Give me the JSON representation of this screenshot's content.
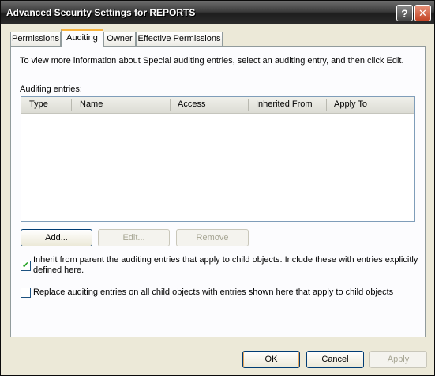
{
  "window": {
    "title": "Advanced Security Settings for REPORTS",
    "help_icon": "?",
    "close_icon": "✕"
  },
  "tabs": [
    {
      "label": "Permissions",
      "active": false
    },
    {
      "label": "Auditing",
      "active": true
    },
    {
      "label": "Owner",
      "active": false
    },
    {
      "label": "Effective Permissions",
      "active": false
    }
  ],
  "auditing": {
    "description": "To view more information about Special auditing entries, select an auditing entry, and then click Edit.",
    "entries_label": "Auditing entries:",
    "columns": [
      "Type",
      "Name",
      "Access",
      "Inherited From",
      "Apply To"
    ],
    "rows": [],
    "add_label": "Add...",
    "edit_label": "Edit...",
    "remove_label": "Remove",
    "inherit_checked": true,
    "inherit_label_line1": "Inherit from parent the auditing entries that apply to child objects. Include these with entries explicitly",
    "inherit_label_line2": "defined here.",
    "replace_checked": false,
    "replace_label": "Replace auditing entries on all child objects with entries shown here that apply to child objects",
    "check_glyph": "✔"
  },
  "footer": {
    "ok_label": "OK",
    "cancel_label": "Cancel",
    "apply_label": "Apply"
  }
}
